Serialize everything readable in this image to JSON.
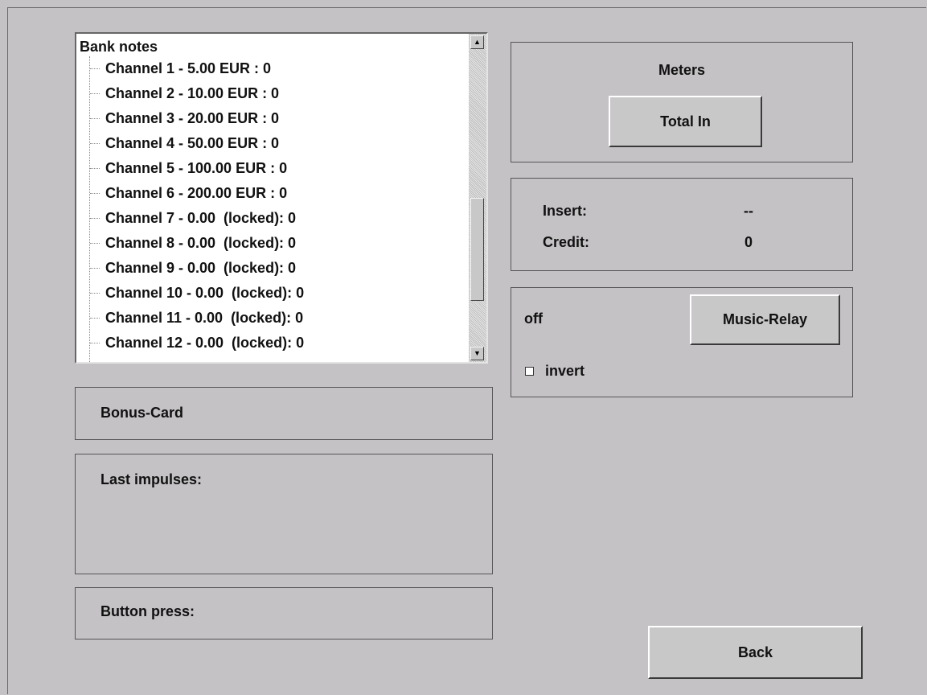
{
  "tree": {
    "root_label": "Bank notes",
    "items": [
      "Channel 1 - 5.00 EUR : 0",
      "Channel 2 - 10.00 EUR : 0",
      "Channel 3 - 20.00 EUR : 0",
      "Channel 4 - 50.00 EUR : 0",
      "Channel 5 - 100.00 EUR : 0",
      "Channel 6 - 200.00 EUR : 0",
      "Channel 7 - 0.00  (locked): 0",
      "Channel 8 - 0.00  (locked): 0",
      "Channel 9 - 0.00  (locked): 0",
      "Channel 10 - 0.00  (locked): 0",
      "Channel 11 - 0.00  (locked): 0",
      "Channel 12 - 0.00  (locked): 0"
    ],
    "scroll_up_icon": "triangle-up",
    "scroll_down_icon": "triangle-down"
  },
  "meters": {
    "title": "Meters",
    "total_in_label": "Total In"
  },
  "status": {
    "insert_label": "Insert:",
    "insert_value": "--",
    "credit_label": "Credit:",
    "credit_value": "0"
  },
  "relay": {
    "state": "off",
    "button_label": "Music-Relay",
    "invert_label": "invert",
    "invert_checked": false
  },
  "bonus_card": {
    "label": "Bonus-Card"
  },
  "last_impulses": {
    "label": "Last impulses:"
  },
  "button_press": {
    "label": "Button press:"
  },
  "footer": {
    "back_label": "Back"
  },
  "colors": {
    "background": "#c5c2c5",
    "list_background": "#ffffff",
    "text": "#111111"
  }
}
